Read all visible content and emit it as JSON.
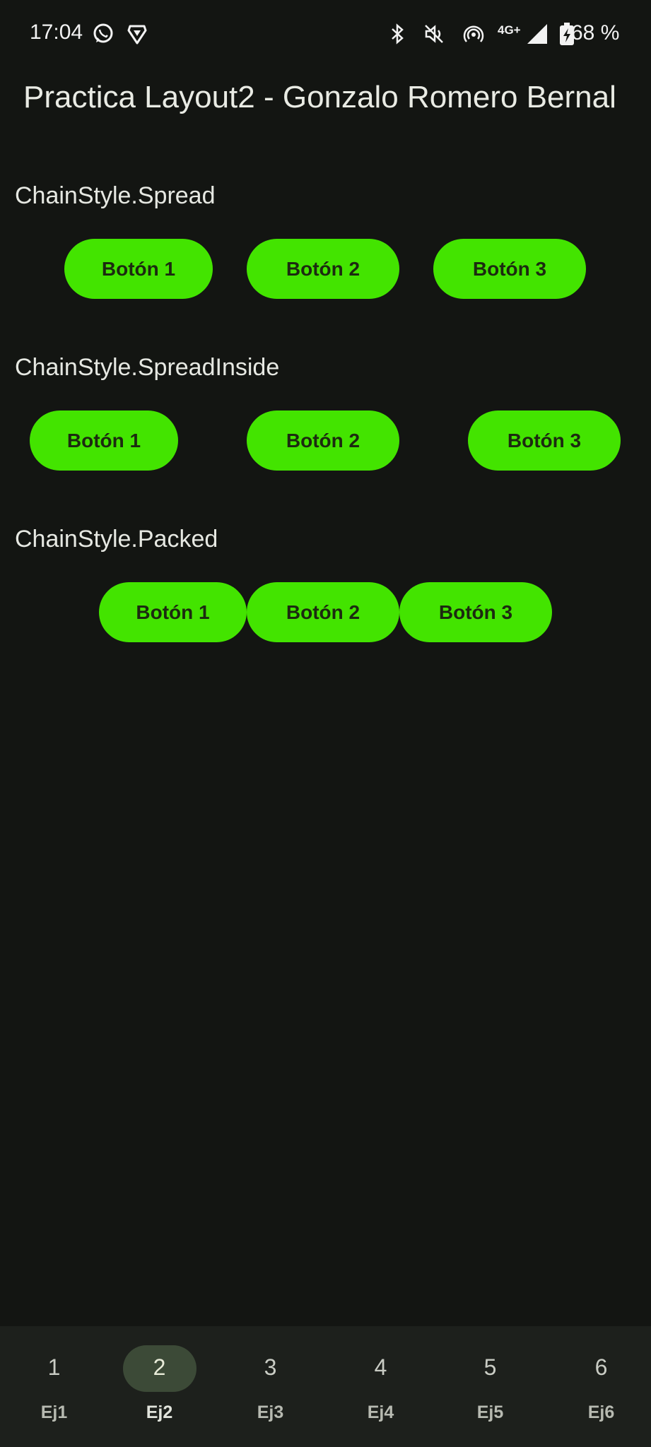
{
  "status_bar": {
    "time": "17:04",
    "network": "4G+",
    "battery": "68 %",
    "icons": [
      "whatsapp-icon",
      "brave-icon",
      "bluetooth-icon",
      "mute-icon",
      "hotspot-icon",
      "signal-icon",
      "battery-charging-icon"
    ]
  },
  "app": {
    "title": "Practica Layout2 - Gonzalo Romero Bernal"
  },
  "sections": [
    {
      "label": "ChainStyle.Spread",
      "buttons": [
        "Botón 1",
        "Botón 2",
        "Botón 3"
      ]
    },
    {
      "label": "ChainStyle.SpreadInside",
      "buttons": [
        "Botón 1",
        "Botón 2",
        "Botón 3"
      ]
    },
    {
      "label": "ChainStyle.Packed",
      "buttons": [
        "Botón 1",
        "Botón 2",
        "Botón 3"
      ]
    }
  ],
  "bottom_nav": {
    "selected": "Ej2",
    "items": [
      {
        "number": "1",
        "label": "Ej1"
      },
      {
        "number": "2",
        "label": "Ej2"
      },
      {
        "number": "3",
        "label": "Ej3"
      },
      {
        "number": "4",
        "label": "Ej4"
      },
      {
        "number": "5",
        "label": "Ej5"
      },
      {
        "number": "6",
        "label": "Ej6"
      }
    ]
  },
  "colors": {
    "background": "#131512",
    "button": "#43e400",
    "button_text": "#1c2a10",
    "nav_background": "#1d201c",
    "nav_selected_pill": "#3c4a37"
  }
}
